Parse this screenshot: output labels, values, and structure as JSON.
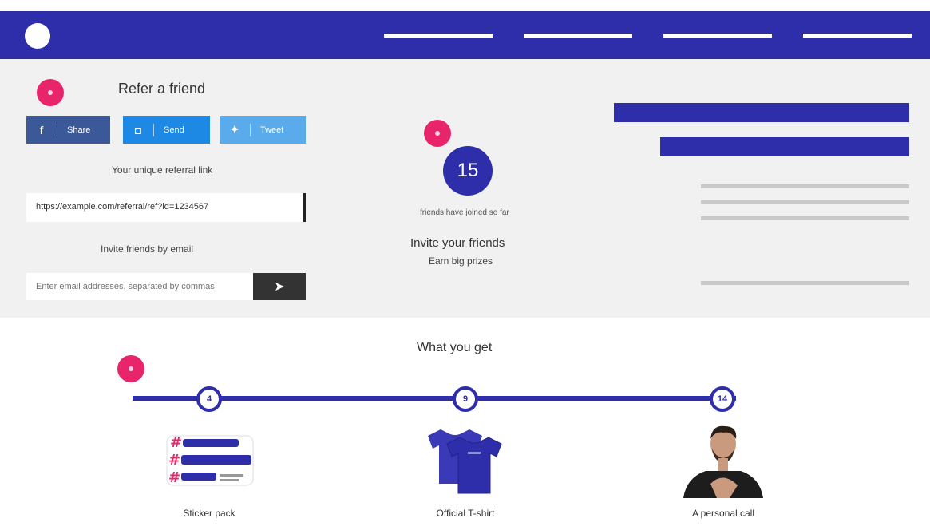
{
  "header": {
    "nav_count": 4
  },
  "markers": {
    "share_section": "•",
    "counter_section": "•",
    "rewards_section": "•"
  },
  "share": {
    "title": "Refer a friend",
    "facebook_label": "Share",
    "messenger_label": "Send",
    "twitter_label": "Tweet",
    "facebook_icon": "f",
    "messenger_icon": "◘",
    "twitter_icon": "✦"
  },
  "link": {
    "label": "Your unique referral link",
    "value": "https://example.com/referral/ref?id=1234567"
  },
  "email": {
    "label": "Invite friends by email",
    "placeholder": "Enter email addresses, separated by commas",
    "send_icon": "➤"
  },
  "counter": {
    "value": "15",
    "caption": "friends have joined so far",
    "title": "Invite your friends",
    "subtitle": "Earn big prizes"
  },
  "rewards": {
    "title": "What you get",
    "milestones": [
      {
        "number": "4",
        "caption": "Sticker pack"
      },
      {
        "number": "9",
        "caption": "Official T-shirt"
      },
      {
        "number": "14",
        "caption": "A personal call"
      }
    ]
  },
  "colors": {
    "brand": "#2e2eab",
    "marker": "#e8246b",
    "facebook": "#3b5998",
    "messenger": "#1e88e5",
    "twitter": "#5aabeb"
  }
}
